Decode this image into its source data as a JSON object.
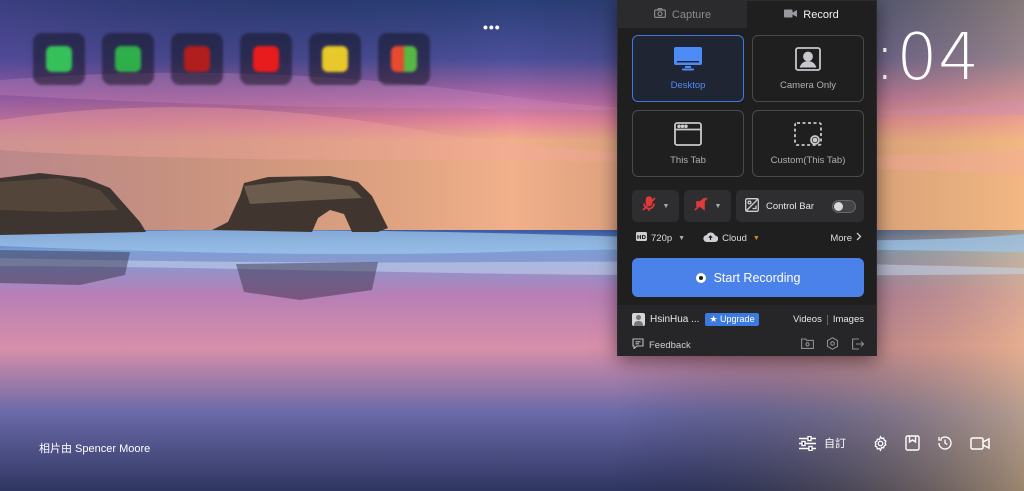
{
  "background": {
    "photo_credit": "相片由 Spencer Moore"
  },
  "shortcuts": [
    {
      "label": "",
      "color": "#36c05a"
    },
    {
      "label": "",
      "color": "#2fae4a"
    },
    {
      "label": "",
      "color": "#b01e1e"
    },
    {
      "label": "",
      "color": "#e81c1c"
    },
    {
      "label": "",
      "color": "#e8c82a"
    },
    {
      "label": "",
      "color": "#3a8ee6"
    }
  ],
  "more_dots": "•••",
  "clock": ":04",
  "bottom_bar": {
    "customize_label": "自訂"
  },
  "panel": {
    "tabs": [
      {
        "label": "Capture",
        "icon": "camera-icon"
      },
      {
        "label": "Record",
        "icon": "video-camera-icon"
      }
    ],
    "modes": [
      {
        "label": "Desktop",
        "icon": "monitor-icon",
        "active": true
      },
      {
        "label": "Camera Only",
        "icon": "webcam-portrait-icon",
        "active": false
      },
      {
        "label": "This Tab",
        "icon": "browser-tab-icon",
        "active": false
      },
      {
        "label": "Custom(This Tab)",
        "icon": "custom-area-icon",
        "active": false
      }
    ],
    "controls": {
      "mic_icon": "mic-off-icon",
      "audio_icon": "audio-off-icon",
      "control_bar_label": "Control Bar",
      "control_bar_on": false
    },
    "options": {
      "resolution": "720p",
      "storage": "Cloud",
      "more_label": "More"
    },
    "start_label": "Start Recording",
    "footer": {
      "username": "HsinHua ...",
      "upgrade_label": "Upgrade",
      "videos_label": "Videos",
      "images_label": "Images",
      "feedback_label": "Feedback"
    },
    "colors": {
      "accent": "#4b82ea",
      "mute_red": "#e03a3a"
    }
  }
}
